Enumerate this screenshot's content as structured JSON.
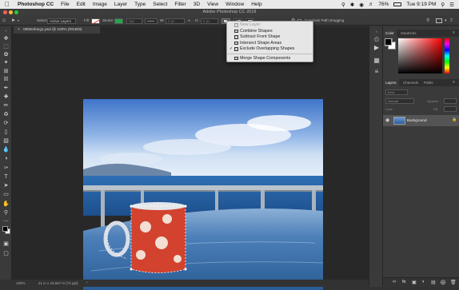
{
  "menubar": {
    "app_name": "Photoshop CC",
    "items": [
      "File",
      "Edit",
      "Image",
      "Layer",
      "Type",
      "Select",
      "Filter",
      "3D",
      "View",
      "Window",
      "Help"
    ],
    "battery": "76%",
    "clock": "Tue 9:19 PM"
  },
  "window": {
    "title": "Adobe Photoshop CC 2019"
  },
  "options_bar": {
    "select_label": "Select:",
    "select_value": "Active Layers",
    "fill_label": "Fill:",
    "stroke_label": "Stroke:",
    "stroke_width": "0px",
    "w_label": "W:",
    "w_value": "0 px",
    "h_label": "H:",
    "h_value": "0 px",
    "constrain_label": "Constrain Path Dragging"
  },
  "document": {
    "tab_label": "08Working1.psd @ 100% (RGB/8)",
    "zoom": "100%",
    "dimensions": "21 in x 16.667 in (72 ppi)"
  },
  "path_ops_menu": {
    "items": [
      {
        "label": "New Layer",
        "enabled": false,
        "checked": false
      },
      {
        "label": "Combine Shapes",
        "enabled": true,
        "checked": false
      },
      {
        "label": "Subtract Front Shape",
        "enabled": true,
        "checked": false
      },
      {
        "label": "Intersect Shape Areas",
        "enabled": true,
        "checked": false
      },
      {
        "label": "Exclude Overlapping Shapes",
        "enabled": true,
        "checked": true
      }
    ],
    "merge_label": "Merge Shape Components"
  },
  "color_panel": {
    "tabs": [
      "Color",
      "Swatches"
    ],
    "active_tab": "Color"
  },
  "layers_panel": {
    "tabs": [
      "Layers",
      "Channels",
      "Paths"
    ],
    "active_tab": "Layers",
    "kind_filter": "Kind",
    "blend_mode": "Normal",
    "opacity_label": "Opacity:",
    "fill_label": "Fill:",
    "lock_label": "Lock:",
    "layers": [
      {
        "name": "Background",
        "locked": true,
        "visible": true
      }
    ]
  },
  "colors": {
    "accent": "#2d6bd1",
    "stroke_swatch": "#23a64b"
  }
}
